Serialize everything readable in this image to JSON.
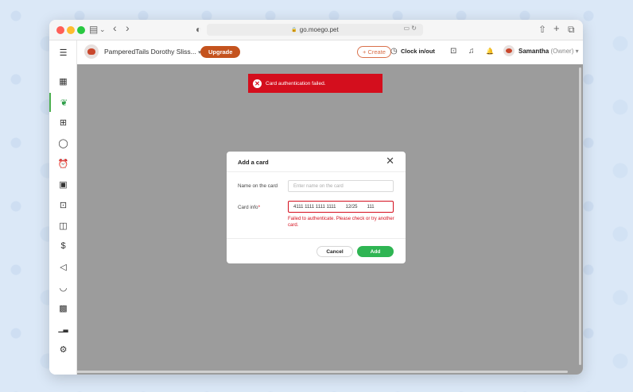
{
  "browser": {
    "url": "go.moego.pet",
    "lock_icon": "lock-icon",
    "tb_icons": {
      "sidebar": "▤",
      "chevron": "⌄",
      "back": "‹",
      "forward": "›",
      "shield": "◐",
      "share": "⇧",
      "newtab": "+",
      "tabs": "⧉",
      "reader": "▭",
      "reload": "↻",
      "lock": "🔒"
    }
  },
  "appbar": {
    "business": "PamperedTails Dorothy Sliss...",
    "business_caret": "▾",
    "upgrade": "Upgrade",
    "create": "+ Create",
    "clock": "Clock in/out",
    "user": "Samantha",
    "role": "(Owner)",
    "user_caret": "▾",
    "icons": {
      "clock": "◷",
      "timesheet": "⊡",
      "headset": "♫",
      "bell": "🔔"
    }
  },
  "sidebar": {
    "menu_icon": "☰",
    "items": [
      {
        "name": "calendar-icon",
        "glyph": "▦"
      },
      {
        "name": "dog-icon",
        "glyph": "❦"
      },
      {
        "name": "store-icon",
        "glyph": "⊞"
      },
      {
        "name": "chat-icon",
        "glyph": "◯"
      },
      {
        "name": "alarm-icon",
        "glyph": "⏰"
      },
      {
        "name": "briefcase-icon",
        "glyph": "▣"
      },
      {
        "name": "contact-icon",
        "glyph": "⊡"
      },
      {
        "name": "reports-icon",
        "glyph": "◫"
      },
      {
        "name": "dollar-icon",
        "glyph": "$"
      },
      {
        "name": "megaphone-icon",
        "glyph": "◁"
      },
      {
        "name": "basket-icon",
        "glyph": "◡"
      },
      {
        "name": "image-icon",
        "glyph": "▩"
      },
      {
        "name": "chart-icon",
        "glyph": "▁▃"
      },
      {
        "name": "settings-icon",
        "glyph": "⚙"
      }
    ]
  },
  "toast": {
    "message": "Card authentication failed.",
    "icon": "✕"
  },
  "modal": {
    "title": "Add a card",
    "close": "✕",
    "name_label": "Name on the card",
    "name_placeholder": "Enter name on the card",
    "card_label": "Card info",
    "card_required": "*",
    "card_number": "4111 1111 1111 1111",
    "card_expiry": "12/25",
    "card_cvc": "111",
    "error": "Failed to authenticate. Please check or try another card.",
    "cancel": "Cancel",
    "add": "Add"
  },
  "colors": {
    "accent": "#c4531e",
    "error": "#d40e1d",
    "success": "#2fb553",
    "active_nav": "#4caf50"
  }
}
